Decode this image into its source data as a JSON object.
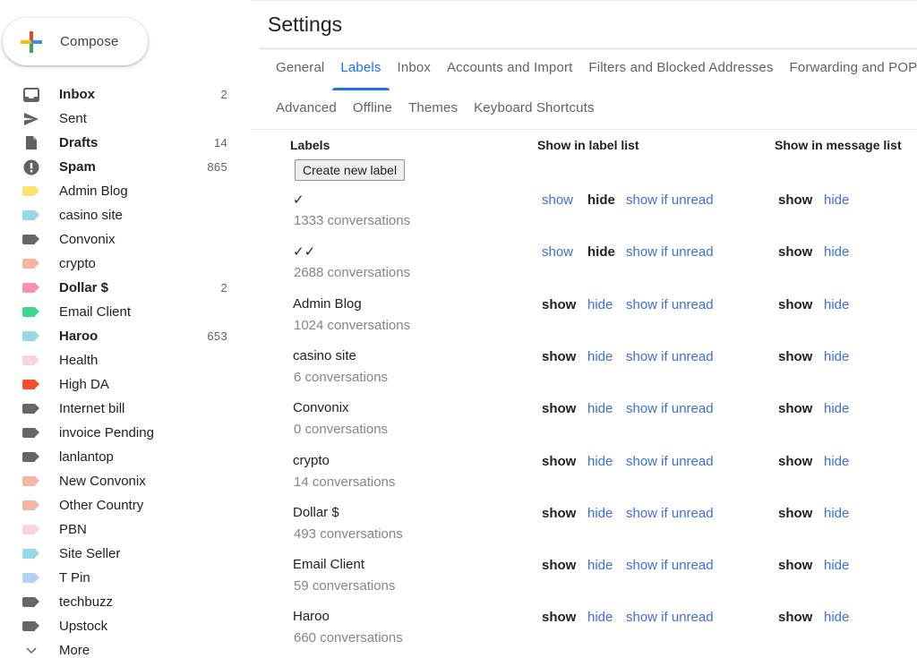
{
  "compose": {
    "label": "Compose"
  },
  "sidebar": {
    "items": [
      {
        "label": "Inbox",
        "count": "2",
        "bold": true,
        "icon": "inbox-icon"
      },
      {
        "label": "Sent",
        "count": "",
        "bold": false,
        "icon": "send-icon"
      },
      {
        "label": "Drafts",
        "count": "14",
        "bold": true,
        "icon": "draft-icon"
      },
      {
        "label": "Spam",
        "count": "865",
        "bold": true,
        "icon": "spam-icon"
      },
      {
        "label": "Admin Blog",
        "count": "",
        "bold": false,
        "icon": "label-icon",
        "color": "#fde272"
      },
      {
        "label": "casino site",
        "count": "",
        "bold": false,
        "icon": "label-icon",
        "color": "#98d7e4"
      },
      {
        "label": "Convonix",
        "count": "",
        "bold": false,
        "icon": "label-icon",
        "color": "#666666"
      },
      {
        "label": "crypto",
        "count": "",
        "bold": false,
        "icon": "label-icon",
        "color": "#f6b3a6"
      },
      {
        "label": "Dollar $",
        "count": "2",
        "bold": true,
        "icon": "label-icon",
        "color": "#f691b3"
      },
      {
        "label": "Email Client",
        "count": "",
        "bold": false,
        "icon": "label-icon",
        "color": "#43d692"
      },
      {
        "label": "Haroo",
        "count": "653",
        "bold": true,
        "icon": "label-icon",
        "color": "#98d7e4"
      },
      {
        "label": "Health",
        "count": "",
        "bold": false,
        "icon": "label-icon",
        "color": "#fbd3e0"
      },
      {
        "label": "High DA",
        "count": "",
        "bold": false,
        "icon": "label-icon",
        "color": "#fb4c2f"
      },
      {
        "label": "Internet bill",
        "count": "",
        "bold": false,
        "icon": "label-icon",
        "color": "#666666"
      },
      {
        "label": "invoice Pending",
        "count": "",
        "bold": false,
        "icon": "label-icon",
        "color": "#666666"
      },
      {
        "label": "lanlantop",
        "count": "",
        "bold": false,
        "icon": "label-icon",
        "color": "#666666"
      },
      {
        "label": "New Convonix",
        "count": "",
        "bold": false,
        "icon": "label-icon",
        "color": "#f6b3a6"
      },
      {
        "label": "Other Country",
        "count": "",
        "bold": false,
        "icon": "label-icon",
        "color": "#f6b3a6"
      },
      {
        "label": "PBN",
        "count": "",
        "bold": false,
        "icon": "label-icon",
        "color": "#fbd3e0"
      },
      {
        "label": "Site Seller",
        "count": "",
        "bold": false,
        "icon": "label-icon",
        "color": "#98d7e4"
      },
      {
        "label": "T Pin",
        "count": "",
        "bold": false,
        "icon": "label-icon",
        "color": "#b6cff5"
      },
      {
        "label": "techbuzz",
        "count": "",
        "bold": false,
        "icon": "label-icon",
        "color": "#666666"
      },
      {
        "label": "Upstock",
        "count": "",
        "bold": false,
        "icon": "label-icon",
        "color": "#666666"
      },
      {
        "label": "More",
        "count": "",
        "bold": false,
        "icon": "chevron-down-icon"
      }
    ]
  },
  "settings": {
    "title": "Settings",
    "tabs_row1": [
      "General",
      "Labels",
      "Inbox",
      "Accounts and Import",
      "Filters and Blocked Addresses",
      "Forwarding and POP/IMAP"
    ],
    "tabs_row2": [
      "Advanced",
      "Offline",
      "Themes",
      "Keyboard Shortcuts"
    ],
    "active_tab": "Labels",
    "columns": {
      "labels": "Labels",
      "show_in_label_list": "Show in label list",
      "show_in_message_list": "Show in message list"
    },
    "create_button": "Create new label",
    "options": {
      "show": "show",
      "hide": "hide",
      "show_if_unread": "show if unread"
    },
    "rows": [
      {
        "name": "✓",
        "conversations": "1333 conversations",
        "label_list": "hide",
        "message_list": "show"
      },
      {
        "name": "✓✓",
        "conversations": "2688 conversations",
        "label_list": "hide",
        "message_list": "show"
      },
      {
        "name": "Admin Blog",
        "conversations": "1024 conversations",
        "label_list": "show",
        "message_list": "show"
      },
      {
        "name": "casino site",
        "conversations": "6 conversations",
        "label_list": "show",
        "message_list": "show"
      },
      {
        "name": "Convonix",
        "conversations": "0 conversations",
        "label_list": "show",
        "message_list": "show"
      },
      {
        "name": "crypto",
        "conversations": "14 conversations",
        "label_list": "show",
        "message_list": "show"
      },
      {
        "name": "Dollar $",
        "conversations": "493 conversations",
        "label_list": "show",
        "message_list": "show"
      },
      {
        "name": "Email Client",
        "conversations": "59 conversations",
        "label_list": "show",
        "message_list": "show"
      },
      {
        "name": "Haroo",
        "conversations": "660 conversations",
        "label_list": "show",
        "message_list": "show"
      }
    ]
  }
}
